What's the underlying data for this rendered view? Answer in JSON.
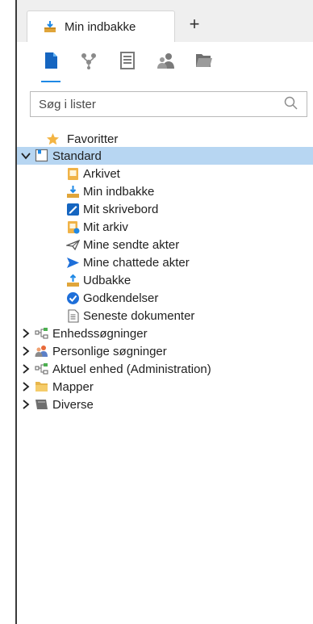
{
  "tabs": [
    {
      "label": "Min indbakke",
      "icon": "inbox-tray-icon"
    }
  ],
  "add_tab_label": "+",
  "toolbar": {
    "buttons": [
      {
        "icon": "document-icon",
        "active": true
      },
      {
        "icon": "org-tree-icon",
        "active": false
      },
      {
        "icon": "list-icon",
        "active": false
      },
      {
        "icon": "users-icon",
        "active": false
      },
      {
        "icon": "folders-icon",
        "active": false
      }
    ],
    "accent": "#1e88e5"
  },
  "search": {
    "placeholder": "Søg i lister",
    "value": ""
  },
  "tree": {
    "favorites": "Favoritter",
    "standard": "Standard",
    "standard_children": [
      "Arkivet",
      "Min indbakke",
      "Mit skrivebord",
      "Mit arkiv",
      "Mine sendte akter",
      "Mine chattede akter",
      "Udbakke",
      "Godkendelser",
      "Seneste dokumenter"
    ],
    "groups": [
      "Enhedssøgninger",
      "Personlige søgninger",
      "Aktuel enhed (Administration)",
      "Mapper",
      "Diverse"
    ],
    "selected_color": "#b7d6f2"
  }
}
